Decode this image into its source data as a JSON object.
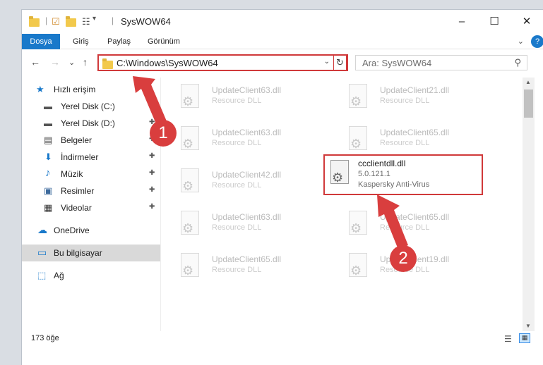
{
  "window": {
    "title": "SysWOW64",
    "controls": {
      "minimize": "–",
      "maximize": "☐",
      "close": "✕"
    }
  },
  "ribbon": {
    "tabs": [
      "Dosya",
      "Giriş",
      "Paylaş",
      "Görünüm"
    ],
    "expand": "⌄",
    "help": "?"
  },
  "nav": {
    "back": "←",
    "forward": "→",
    "recent": "⌄",
    "up": "↑",
    "address": "C:\\Windows\\SysWOW64",
    "address_dropdown": "⌄",
    "refresh": "↻",
    "search_placeholder": "Ara: SysWOW64",
    "search_icon": "⚲"
  },
  "sidebar": {
    "items": [
      {
        "label": "Hızlı erişim",
        "icon": "star-icon",
        "glyph": "★",
        "color": "#1979ca"
      },
      {
        "label": "Yerel Disk (C:)",
        "icon": "drive-icon",
        "glyph": "▬",
        "color": "#555"
      },
      {
        "label": "Yerel Disk (D:)",
        "icon": "drive-icon",
        "glyph": "▬",
        "color": "#555"
      },
      {
        "label": "Belgeler",
        "icon": "documents-icon",
        "glyph": "▤",
        "color": "#4a4a4a"
      },
      {
        "label": "İndirmeler",
        "icon": "download-icon",
        "glyph": "⬇",
        "color": "#1979ca"
      },
      {
        "label": "Müzik",
        "icon": "music-icon",
        "glyph": "♪",
        "color": "#1979ca"
      },
      {
        "label": "Resimler",
        "icon": "pictures-icon",
        "glyph": "▣",
        "color": "#3c6a9c"
      },
      {
        "label": "Videolar",
        "icon": "videos-icon",
        "glyph": "▦",
        "color": "#333"
      },
      {
        "label": "OneDrive",
        "icon": "onedrive-icon",
        "glyph": "☁",
        "color": "#1979ca"
      },
      {
        "label": "Bu bilgisayar",
        "icon": "computer-icon",
        "glyph": "▭",
        "color": "#1979ca"
      },
      {
        "label": "Ağ",
        "icon": "network-icon",
        "glyph": "⬚",
        "color": "#1979ca"
      }
    ],
    "pin_glyph": "📌"
  },
  "files": {
    "left": [
      {
        "name": "UpdateClient63.dll",
        "desc": "Resource DLL"
      },
      {
        "name": "UpdateClient63.dll",
        "desc": "Resource DLL"
      },
      {
        "name": "UpdateClient42.dll",
        "desc": "Resource DLL"
      },
      {
        "name": "UpdateClient63.dll",
        "desc": "Resource DLL"
      },
      {
        "name": "UpdateClient65.dll",
        "desc": "Resource DLL"
      }
    ],
    "right": [
      {
        "name": "UpdateClient21.dll",
        "desc": "Resource DLL"
      },
      {
        "name": "UpdateClient65.dll",
        "desc": "Resource DLL"
      },
      {
        "name": "UpdateClient65.dll",
        "desc": "Resource DLL"
      },
      {
        "name": "UpdateClient19.dll",
        "desc": "Resource DLL"
      }
    ],
    "highlighted": {
      "name": "ccclientdll.dll",
      "version": "5.0.121.1",
      "desc": "Kaspersky Anti-Virus"
    }
  },
  "annotations": {
    "step1": "1",
    "step2": "2"
  },
  "status": {
    "count": "173 öğe"
  },
  "colors": {
    "accent": "#1979ca",
    "annotation_red": "#d0393a"
  }
}
